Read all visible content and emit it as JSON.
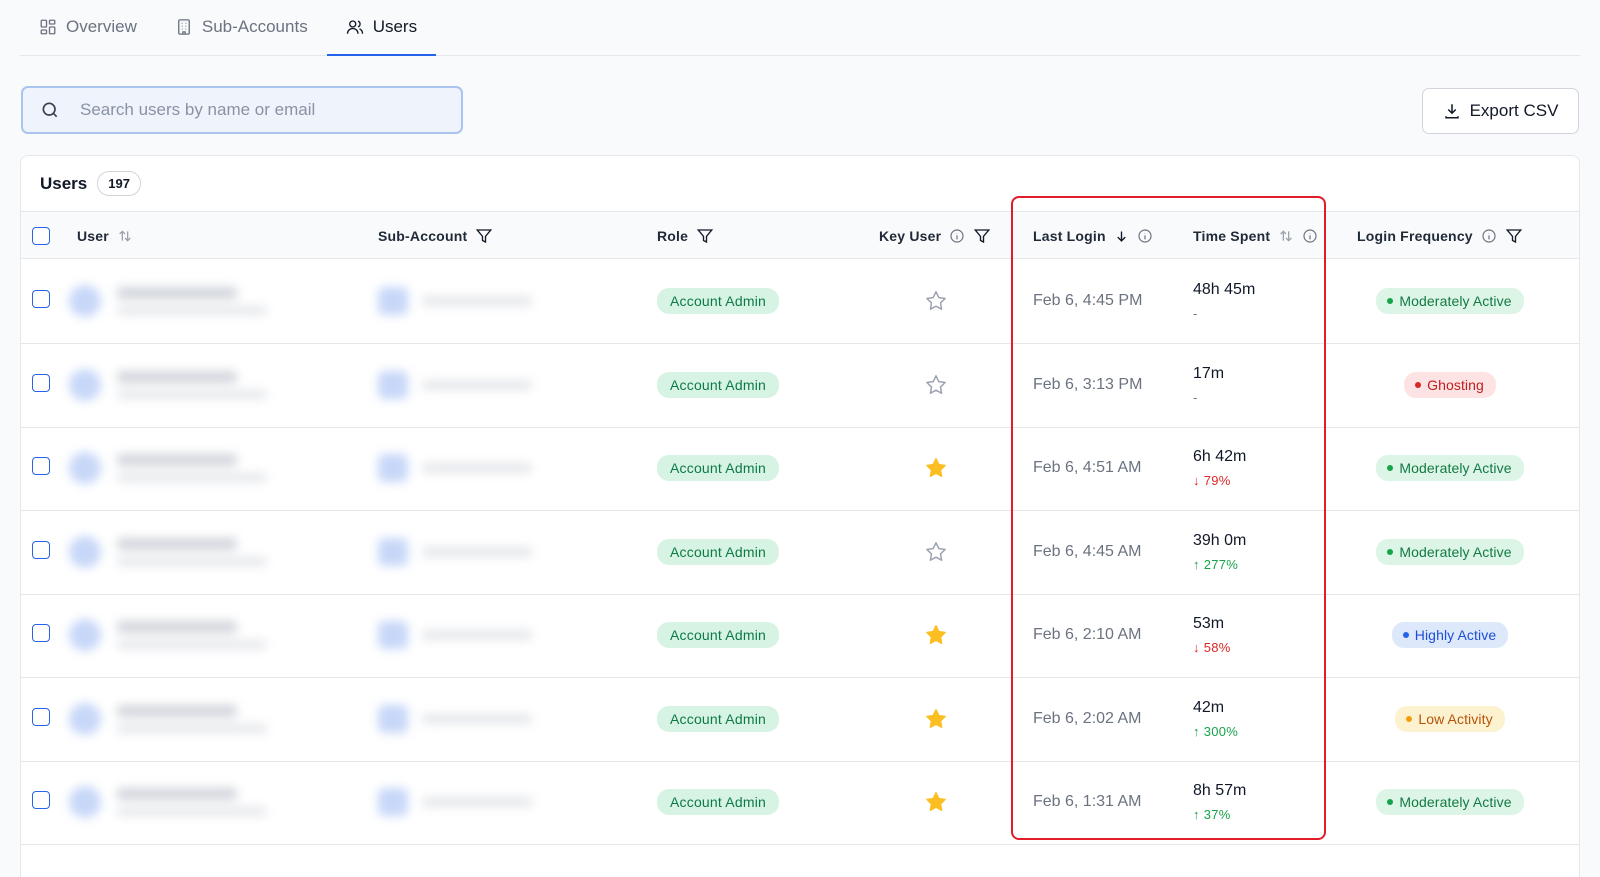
{
  "tabs": [
    {
      "label": "Overview",
      "icon": "dashboard-icon"
    },
    {
      "label": "Sub-Accounts",
      "icon": "building-icon"
    },
    {
      "label": "Users",
      "icon": "users-icon",
      "active": true
    }
  ],
  "search": {
    "placeholder": "Search users by name or email"
  },
  "export": {
    "label": "Export CSV"
  },
  "table": {
    "title": "Users",
    "count": "197",
    "columns": {
      "user": "User",
      "sub_account": "Sub-Account",
      "role": "Role",
      "key_user": "Key User",
      "last_login": "Last Login",
      "time_spent": "Time Spent",
      "login_frequency": "Login Frequency"
    },
    "rows": [
      {
        "role": "Account Admin",
        "key_user": false,
        "last_login": "Feb 6, 4:45 PM",
        "time_spent": "48h 45m",
        "delta": "-",
        "delta_dir": "none",
        "frequency": "Moderately Active",
        "freq_type": "moderate"
      },
      {
        "role": "Account Admin",
        "key_user": false,
        "last_login": "Feb 6, 3:13 PM",
        "time_spent": "17m",
        "delta": "-",
        "delta_dir": "none",
        "frequency": "Ghosting",
        "freq_type": "ghost"
      },
      {
        "role": "Account Admin",
        "key_user": true,
        "last_login": "Feb 6, 4:51 AM",
        "time_spent": "6h 42m",
        "delta": "↓ 79%",
        "delta_dir": "down",
        "frequency": "Moderately Active",
        "freq_type": "moderate"
      },
      {
        "role": "Account Admin",
        "key_user": false,
        "last_login": "Feb 6, 4:45 AM",
        "time_spent": "39h 0m",
        "delta": "↑ 277%",
        "delta_dir": "up",
        "frequency": "Moderately Active",
        "freq_type": "moderate"
      },
      {
        "role": "Account Admin",
        "key_user": true,
        "last_login": "Feb 6, 2:10 AM",
        "time_spent": "53m",
        "delta": "↓ 58%",
        "delta_dir": "down",
        "frequency": "Highly Active",
        "freq_type": "high"
      },
      {
        "role": "Account Admin",
        "key_user": true,
        "last_login": "Feb 6, 2:02 AM",
        "time_spent": "42m",
        "delta": "↑ 300%",
        "delta_dir": "up",
        "frequency": "Low Activity",
        "freq_type": "low"
      },
      {
        "role": "Account Admin",
        "key_user": true,
        "last_login": "Feb 6, 1:31 AM",
        "time_spent": "8h 57m",
        "delta": "↑ 37%",
        "delta_dir": "up",
        "frequency": "Moderately Active",
        "freq_type": "moderate"
      }
    ]
  },
  "colors": {
    "accent": "#2563eb",
    "highlight": "#e11d2a",
    "star_filled": "#fbbf24"
  }
}
